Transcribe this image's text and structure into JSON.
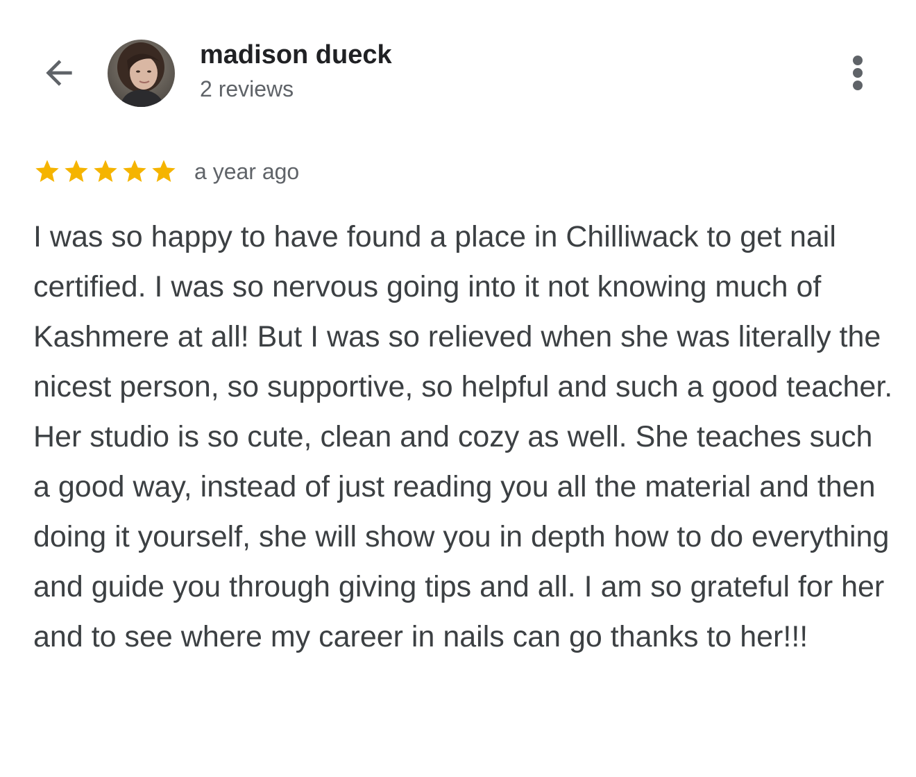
{
  "header": {
    "author_name": "madison dueck",
    "review_count": "2 reviews",
    "back_icon": "arrow-back-icon",
    "more_icon": "more-vertical-icon"
  },
  "review": {
    "rating": 5,
    "rating_max": 5,
    "date": "a year ago",
    "text": "I was so happy to have found a place in Chilliwack to get nail certified. I was so nervous going into it not knowing much of Kashmere at all! But I was so relieved when she was literally the nicest person, so supportive, so helpful and such a good teacher. Her studio is so cute, clean and cozy as well. She teaches such a good way, instead of just reading you all the material and then doing it yourself, she will show you in depth how to do everything and guide you through giving tips and all. I am so grateful for her and to see where my career in nails can go thanks to her!!!"
  },
  "colors": {
    "star": "#f5b400",
    "name": "#202124",
    "secondary": "#5f6368",
    "body_text": "#3c4043",
    "icon": "#5f6368"
  }
}
